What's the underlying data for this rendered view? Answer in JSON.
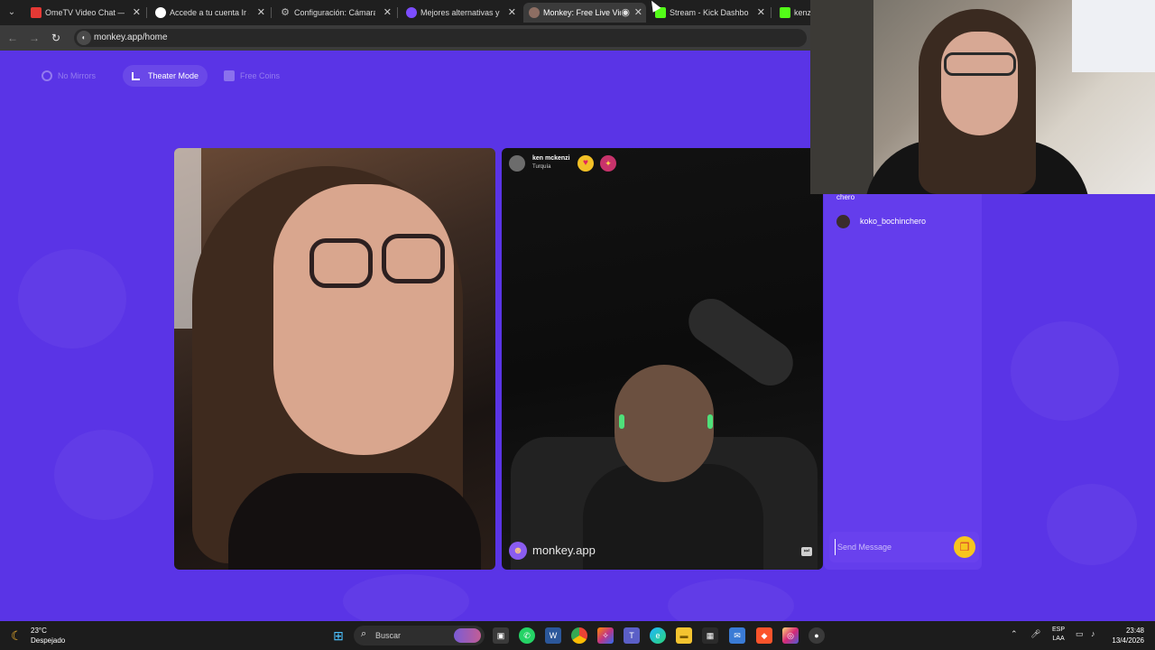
{
  "browser": {
    "tabs": [
      {
        "label": "OmeTV Video Chat — Or",
        "favicon_color": "#e53935"
      },
      {
        "label": "Accede a tu cuenta Ir a th",
        "favicon_color": "#ffffff"
      },
      {
        "label": "Configuración: Cámara",
        "favicon_color": "#9e9e9e"
      },
      {
        "label": "Mejores alternativas y con",
        "favicon_color": "#7c4dff"
      },
      {
        "label": "Monkey: Free Live Vid",
        "favicon_color": "#8d6e63",
        "active": true
      },
      {
        "label": "Stream - Kick Dashboard",
        "favicon_color": "#53fc18"
      },
      {
        "label": "kenzi",
        "favicon_color": "#53fc18"
      }
    ],
    "url": "monkey.app/home"
  },
  "page": {
    "top_controls": [
      {
        "label": "No Mirrors",
        "state": "disabled"
      },
      {
        "label": "Theater Mode",
        "state": "active"
      },
      {
        "label": "Free Coins",
        "state": "disabled"
      }
    ],
    "peer": {
      "name": "ken mckenzi",
      "country": "Turquía"
    },
    "watermark": "monkey.app",
    "chat": {
      "truncated_line": "chero",
      "users": [
        {
          "name": "koko_bochinchero"
        }
      ],
      "input_placeholder": "Send Message"
    }
  },
  "taskbar": {
    "weather": {
      "temp": "23°C",
      "desc": "Despejado"
    },
    "search_label": "Buscar",
    "language": [
      "ESP",
      "LAA"
    ],
    "time": "23:48",
    "date": "13/4/2026"
  },
  "colors": {
    "brand_purple": "#5a34e6",
    "gift_yellow": "#f7c51e",
    "kick_green": "#53fc18"
  }
}
